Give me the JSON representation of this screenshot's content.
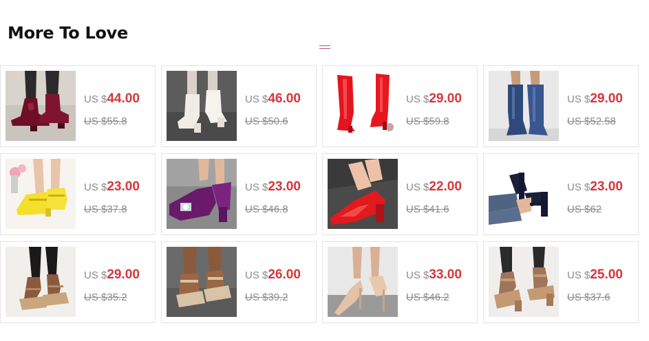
{
  "section": {
    "title": "More To Love",
    "accent": "#b8567a"
  },
  "colors": {
    "price": "#d6363b",
    "muted": "#8a8a8a",
    "border": "#e3e3e3"
  },
  "currency_label": "US $",
  "products": [
    {
      "image": "burgundy-patent-ankle-boots",
      "price": "44.00",
      "original": "US $55.8"
    },
    {
      "image": "white-block-heel-ankle-boots",
      "price": "46.00",
      "original": "US $50.6"
    },
    {
      "image": "red-patent-knee-boots",
      "price": "29.00",
      "original": "US $59.8"
    },
    {
      "image": "blue-knee-high-boots",
      "price": "29.00",
      "original": "US $52.58"
    },
    {
      "image": "yellow-mary-jane-heels",
      "price": "23.00",
      "original": "US $37.8"
    },
    {
      "image": "purple-velvet-rhinestone-pumps",
      "price": "23.00",
      "original": "US $46.8"
    },
    {
      "image": "red-patent-pumps",
      "price": "22.00",
      "original": "US $41.6"
    },
    {
      "image": "navy-platform-strap-heels",
      "price": "23.00",
      "original": "US $62"
    },
    {
      "image": "tan-wedge-sandals",
      "price": "29.00",
      "original": "US $35.2"
    },
    {
      "image": "beige-platform-sandals",
      "price": "26.00",
      "original": "US $39.2"
    },
    {
      "image": "nude-slingback-stilettos",
      "price": "33.00",
      "original": "US $46.2"
    },
    {
      "image": "tan-block-heel-sandals",
      "price": "25.00",
      "original": "US $37.6"
    }
  ]
}
